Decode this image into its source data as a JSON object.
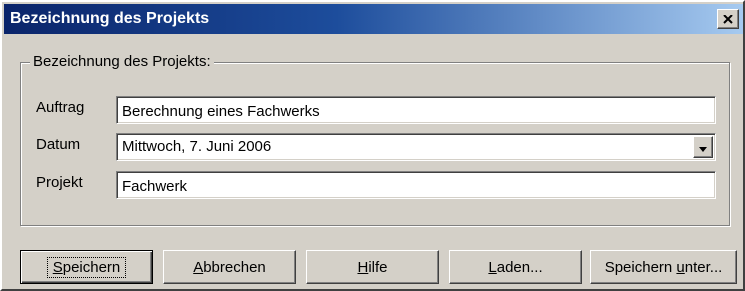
{
  "window": {
    "title": "Bezeichnung des Projekts"
  },
  "group": {
    "legend": "Bezeichnung des Projekts:"
  },
  "fields": {
    "auftrag": {
      "label": "Auftrag",
      "value": "Berechnung eines Fachwerks"
    },
    "datum": {
      "label": "Datum",
      "value": "Mittwoch, 7. Juni 2006"
    },
    "projekt": {
      "label": "Projekt",
      "value": "Fachwerk"
    }
  },
  "buttons": {
    "speichern": {
      "acc": "S",
      "rest": "peichern"
    },
    "abbrechen": {
      "acc": "A",
      "rest": "bbrechen"
    },
    "hilfe": {
      "acc": "H",
      "rest": "ilfe"
    },
    "laden": {
      "acc": "L",
      "rest": "aden..."
    },
    "speichern_unter": {
      "pre": "Speichern ",
      "acc": "u",
      "rest": "nter..."
    }
  },
  "icons": {
    "close": "close-icon",
    "dropdown": "chevron-down-icon"
  },
  "colors": {
    "titlebar_start": "#0a246a",
    "titlebar_end": "#a6caf0",
    "face": "#d4d0c8"
  }
}
